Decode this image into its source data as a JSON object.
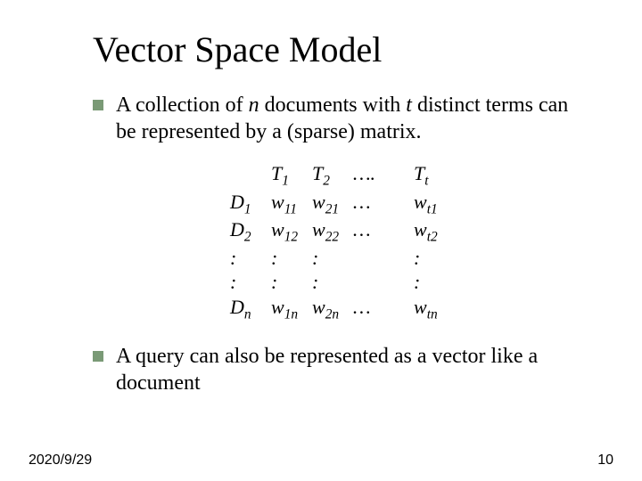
{
  "title": "Vector Space Model",
  "bullets": [
    {
      "pre": "A collection of ",
      "n": "n",
      "mid1": " documents with ",
      "t": "t",
      "post": " distinct terms can be represented by a (sparse) matrix."
    },
    {
      "text": "A query can also be represented as a vector like a document"
    }
  ],
  "matrix": {
    "header": {
      "blank": "",
      "T1": "T",
      "T1s": "1",
      "T2": "T",
      "T2s": "2",
      "dots": "….",
      "Tt": "T",
      "Tts": "t"
    },
    "rows": [
      {
        "label": "D",
        "labels": "1",
        "c1": "w",
        "c1s": "11",
        "c2": "w",
        "c2s": "21",
        "d": "…",
        "ct": "w",
        "cts": "t1"
      },
      {
        "label": "D",
        "labels": "2",
        "c1": "w",
        "c1s": "12",
        "c2": "w",
        "c2s": "22",
        "d": "…",
        "ct": "w",
        "cts": "t2"
      },
      {
        "label": ":",
        "c1": ":",
        "c2": ":",
        "d": "",
        "ct": ":"
      },
      {
        "label": ":",
        "c1": ":",
        "c2": ":",
        "d": "",
        "ct": ":"
      },
      {
        "label": "D",
        "labels": "n",
        "c1": "w",
        "c1s": "1n",
        "c2": "w",
        "c2s": "2n",
        "d": "…",
        "ct": "w",
        "cts": "tn"
      }
    ]
  },
  "footer": {
    "date": "2020/9/29",
    "page": "10"
  }
}
